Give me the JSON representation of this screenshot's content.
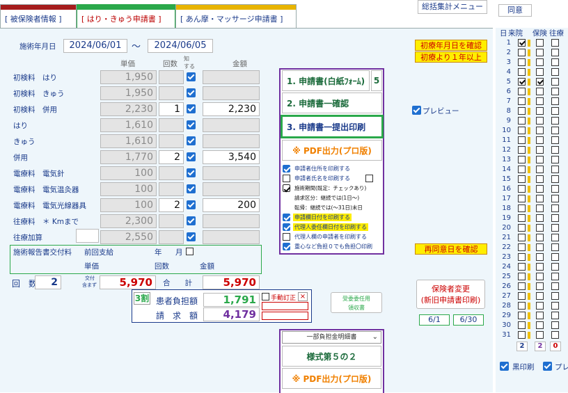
{
  "tabs": [
    {
      "label": "[ 被保険者情報 ]",
      "color": "#a51c1c"
    },
    {
      "label": "[ はり・きゅう申請書 ]",
      "color": "#2aa84a"
    },
    {
      "label": "[ あん摩・マッサージ申請書 ]",
      "color": "#e8b400"
    }
  ],
  "top_buttons": {
    "summary": "総括集計メニュー",
    "consent": "同意"
  },
  "period": {
    "label": "施術年月日",
    "from": "2024/06/01",
    "sep": "～",
    "to": "2024/06/05"
  },
  "headers": {
    "unit": "単価",
    "count": "回数",
    "notify1": "知",
    "notify2": "する",
    "notify3": "",
    "amount": "金額"
  },
  "rows": [
    {
      "label": "初検料　はり",
      "unit": "1,950",
      "count": "",
      "amount": ""
    },
    {
      "label": "初検料　きゅう",
      "unit": "1,950",
      "count": "",
      "amount": ""
    },
    {
      "label": "初検料　併用",
      "unit": "2,230",
      "count": "1",
      "amount": "2,230"
    },
    {
      "label": "はり",
      "unit": "1,610",
      "count": "",
      "amount": ""
    },
    {
      "label": "きゅう",
      "unit": "1,610",
      "count": "",
      "amount": ""
    },
    {
      "label": "併用",
      "unit": "1,770",
      "count": "2",
      "amount": "3,540"
    },
    {
      "label": "電療料　電気針",
      "unit": "100",
      "count": "",
      "amount": ""
    },
    {
      "label": "電療料　電気温灸器",
      "unit": "100",
      "count": "",
      "amount": ""
    },
    {
      "label": "電療料　電気光線器具",
      "unit": "100",
      "count": "2",
      "amount": "200"
    },
    {
      "label": "往療料　＊ Kmまで",
      "unit": "2,300",
      "count": "",
      "amount": ""
    },
    {
      "label": "往療加算",
      "unit": "2,550",
      "count": "",
      "amount": ""
    }
  ],
  "report": {
    "title": "施術報告書交付料",
    "prev": "前回支給",
    "year": "年",
    "month": "月",
    "unit": "単価",
    "count": "回数",
    "amount": "金額"
  },
  "totals": {
    "count_label": "回　数",
    "count": "2",
    "fee_note1": "交付",
    "fee_note2": "含まず",
    "fee": "5,970",
    "sum_label": "合　　計",
    "sum": "5,970"
  },
  "burden": {
    "ratio": "3割",
    "burden_label": "患者負担額",
    "burden": "1,791",
    "manual": "手動訂正",
    "x": "×",
    "bill_label": "請　求　額",
    "bill": "4,179"
  },
  "print_menu": {
    "btn1": "1. 申請書(白紙ﾌｫｰﾑ)",
    "btn1_num": "5",
    "btn2": "2. 申請書一確認",
    "btn3": "3. 申請書一提出印刷",
    "pdf": "※ PDF出力(プロ版)",
    "options": [
      {
        "label": "申請者住所を印刷する",
        "checked": true,
        "hl": false
      },
      {
        "label": "申請者氏名を印刷する",
        "checked": false,
        "hl": false
      },
      {
        "label": "施術期間(既定：チェックあり)",
        "checked": true,
        "hl": false
      },
      {
        "label": "請求区分：継続では(1日～)",
        "checked": null,
        "hl": false
      },
      {
        "label": "転帰：継続では(～31日)末日",
        "checked": null,
        "hl": false
      },
      {
        "label": "申請欄日付を印刷する",
        "checked": true,
        "hl": true
      },
      {
        "label": "代理人委任欄日付を印刷する",
        "checked": true,
        "hl": true
      },
      {
        "label": "代理人欄の申請者を印刷する",
        "checked": false,
        "hl": false
      },
      {
        "label": "重心など負担０でも負担〇印刷",
        "checked": true,
        "hl": false
      }
    ]
  },
  "preview": "プレビュー",
  "yellow": {
    "confirm_first": "初療年月日を確認",
    "over_year": "初療より１年以上",
    "reconfirm": "再同意日を確認"
  },
  "insurer_change": {
    "line1": "保険者変更",
    "line2": "(新旧申請書印刷)"
  },
  "dates": {
    "d1": "6/1",
    "d2": "6/30"
  },
  "proxy": {
    "line1": "受委委任用",
    "line2": "領収書"
  },
  "bottom": {
    "dropdown": "一部負担金明細書",
    "form5": "様式第５の２",
    "pdf": "※ PDF出力(プロ版)"
  },
  "right": {
    "h_day": "日",
    "h_visit": "来院",
    "h_ins": "保険",
    "h_ret": "往療",
    "counts": [
      "2",
      "2",
      "0"
    ],
    "black": "黒印刷",
    "pre": "プレ"
  },
  "days": [
    1,
    2,
    3,
    4,
    5,
    6,
    7,
    8,
    9,
    10,
    11,
    12,
    13,
    14,
    15,
    16,
    17,
    18,
    19,
    20,
    21,
    22,
    23,
    24,
    25,
    26,
    27,
    28,
    29,
    30,
    31
  ],
  "checked_days": [
    1,
    5
  ],
  "colors": {
    "accent": "#1f6fd0",
    "yellow": "#ffee00",
    "red": "#c00000",
    "green": "#2aa84a"
  }
}
